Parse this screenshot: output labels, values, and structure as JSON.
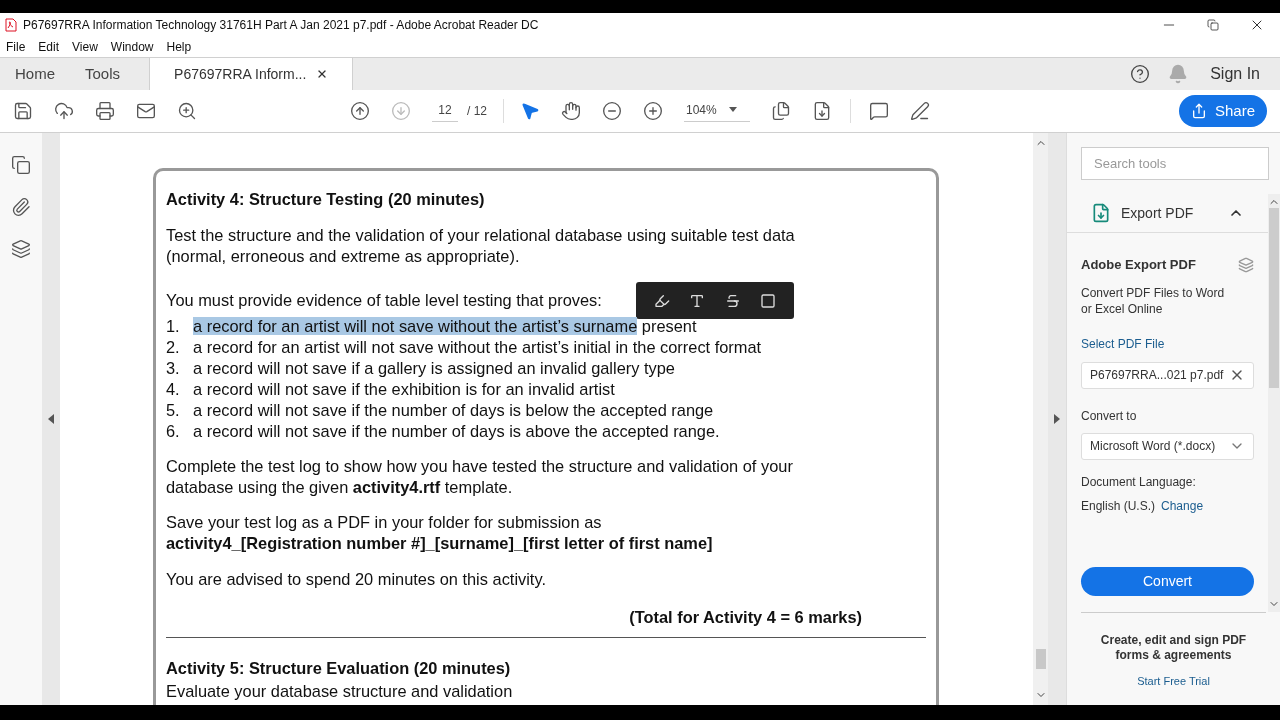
{
  "window": {
    "title": "P67697RRA Information Technology 31761H Part A Jan 2021 p7.pdf - Adobe Acrobat Reader DC"
  },
  "menu": [
    "File",
    "Edit",
    "View",
    "Window",
    "Help"
  ],
  "tabs": [
    {
      "label": "Home",
      "selected": false
    },
    {
      "label": "Tools",
      "selected": false
    },
    {
      "label": "P67697RRA Inform...",
      "selected": true,
      "closable": true
    }
  ],
  "sign_in": "Sign In",
  "toolbar": {
    "page": "12",
    "page_total": "/ 12",
    "zoom": "104%"
  },
  "share": "Share",
  "document": {
    "heading": "Activity 4: Structure Testing (20 minutes)",
    "intro": "Test the structure and the validation of your relational database using suitable test data (normal, erroneous and extreme as appropriate).",
    "lead": "You must provide evidence of table level testing that proves:",
    "items": [
      {
        "number": "1.",
        "selected_text": "a record for an artist will not save without the artist’s surname",
        "text": " present"
      },
      {
        "number": "2.",
        "text": "a record for an artist will not save without the artist’s initial in the correct format"
      },
      {
        "number": "3.",
        "text": "a record will not save if a gallery is assigned an invalid gallery type"
      },
      {
        "number": "4.",
        "text": "a record will not save if the exhibition is for an invalid artist"
      },
      {
        "number": "5.",
        "text": "a record will not save if the number of days is below the accepted range"
      },
      {
        "number": "6.",
        "text": "a record will not save if the number of days is above the accepted range."
      }
    ],
    "complete": "Complete the test log to show how you have tested the structure and validation of your database using the given **activity4.rtf** template.",
    "save": "Save your test log as a PDF in your folder for submission as",
    "filename": "activity4_[Registration number #]_[surname]_[first letter of first name]",
    "advice": "You are advised to spend 20 minutes on this activity.",
    "total": "(Total for Activity 4 = 6 marks)",
    "next_heading": "Activity 5: Structure Evaluation (20 minutes)",
    "next_text": "Evaluate your database structure and validation"
  },
  "panel": {
    "search_placeholder": "Search tools",
    "tool": "Export PDF",
    "expanded": true,
    "title": "Adobe Export PDF",
    "description": "Convert PDF Files to Word or Excel Online",
    "select_label": "Select PDF File",
    "file": "P67697RRA...021 p7.pdf",
    "convert_label": "Convert to",
    "format": "Microsoft Word (*.docx)",
    "language_label": "Document Language:",
    "language": "English (U.S.)",
    "change": "Change",
    "convert_button": "Convert",
    "promo": "Create, edit and sign PDF forms & agreements",
    "trial": "Start Free Trial"
  }
}
